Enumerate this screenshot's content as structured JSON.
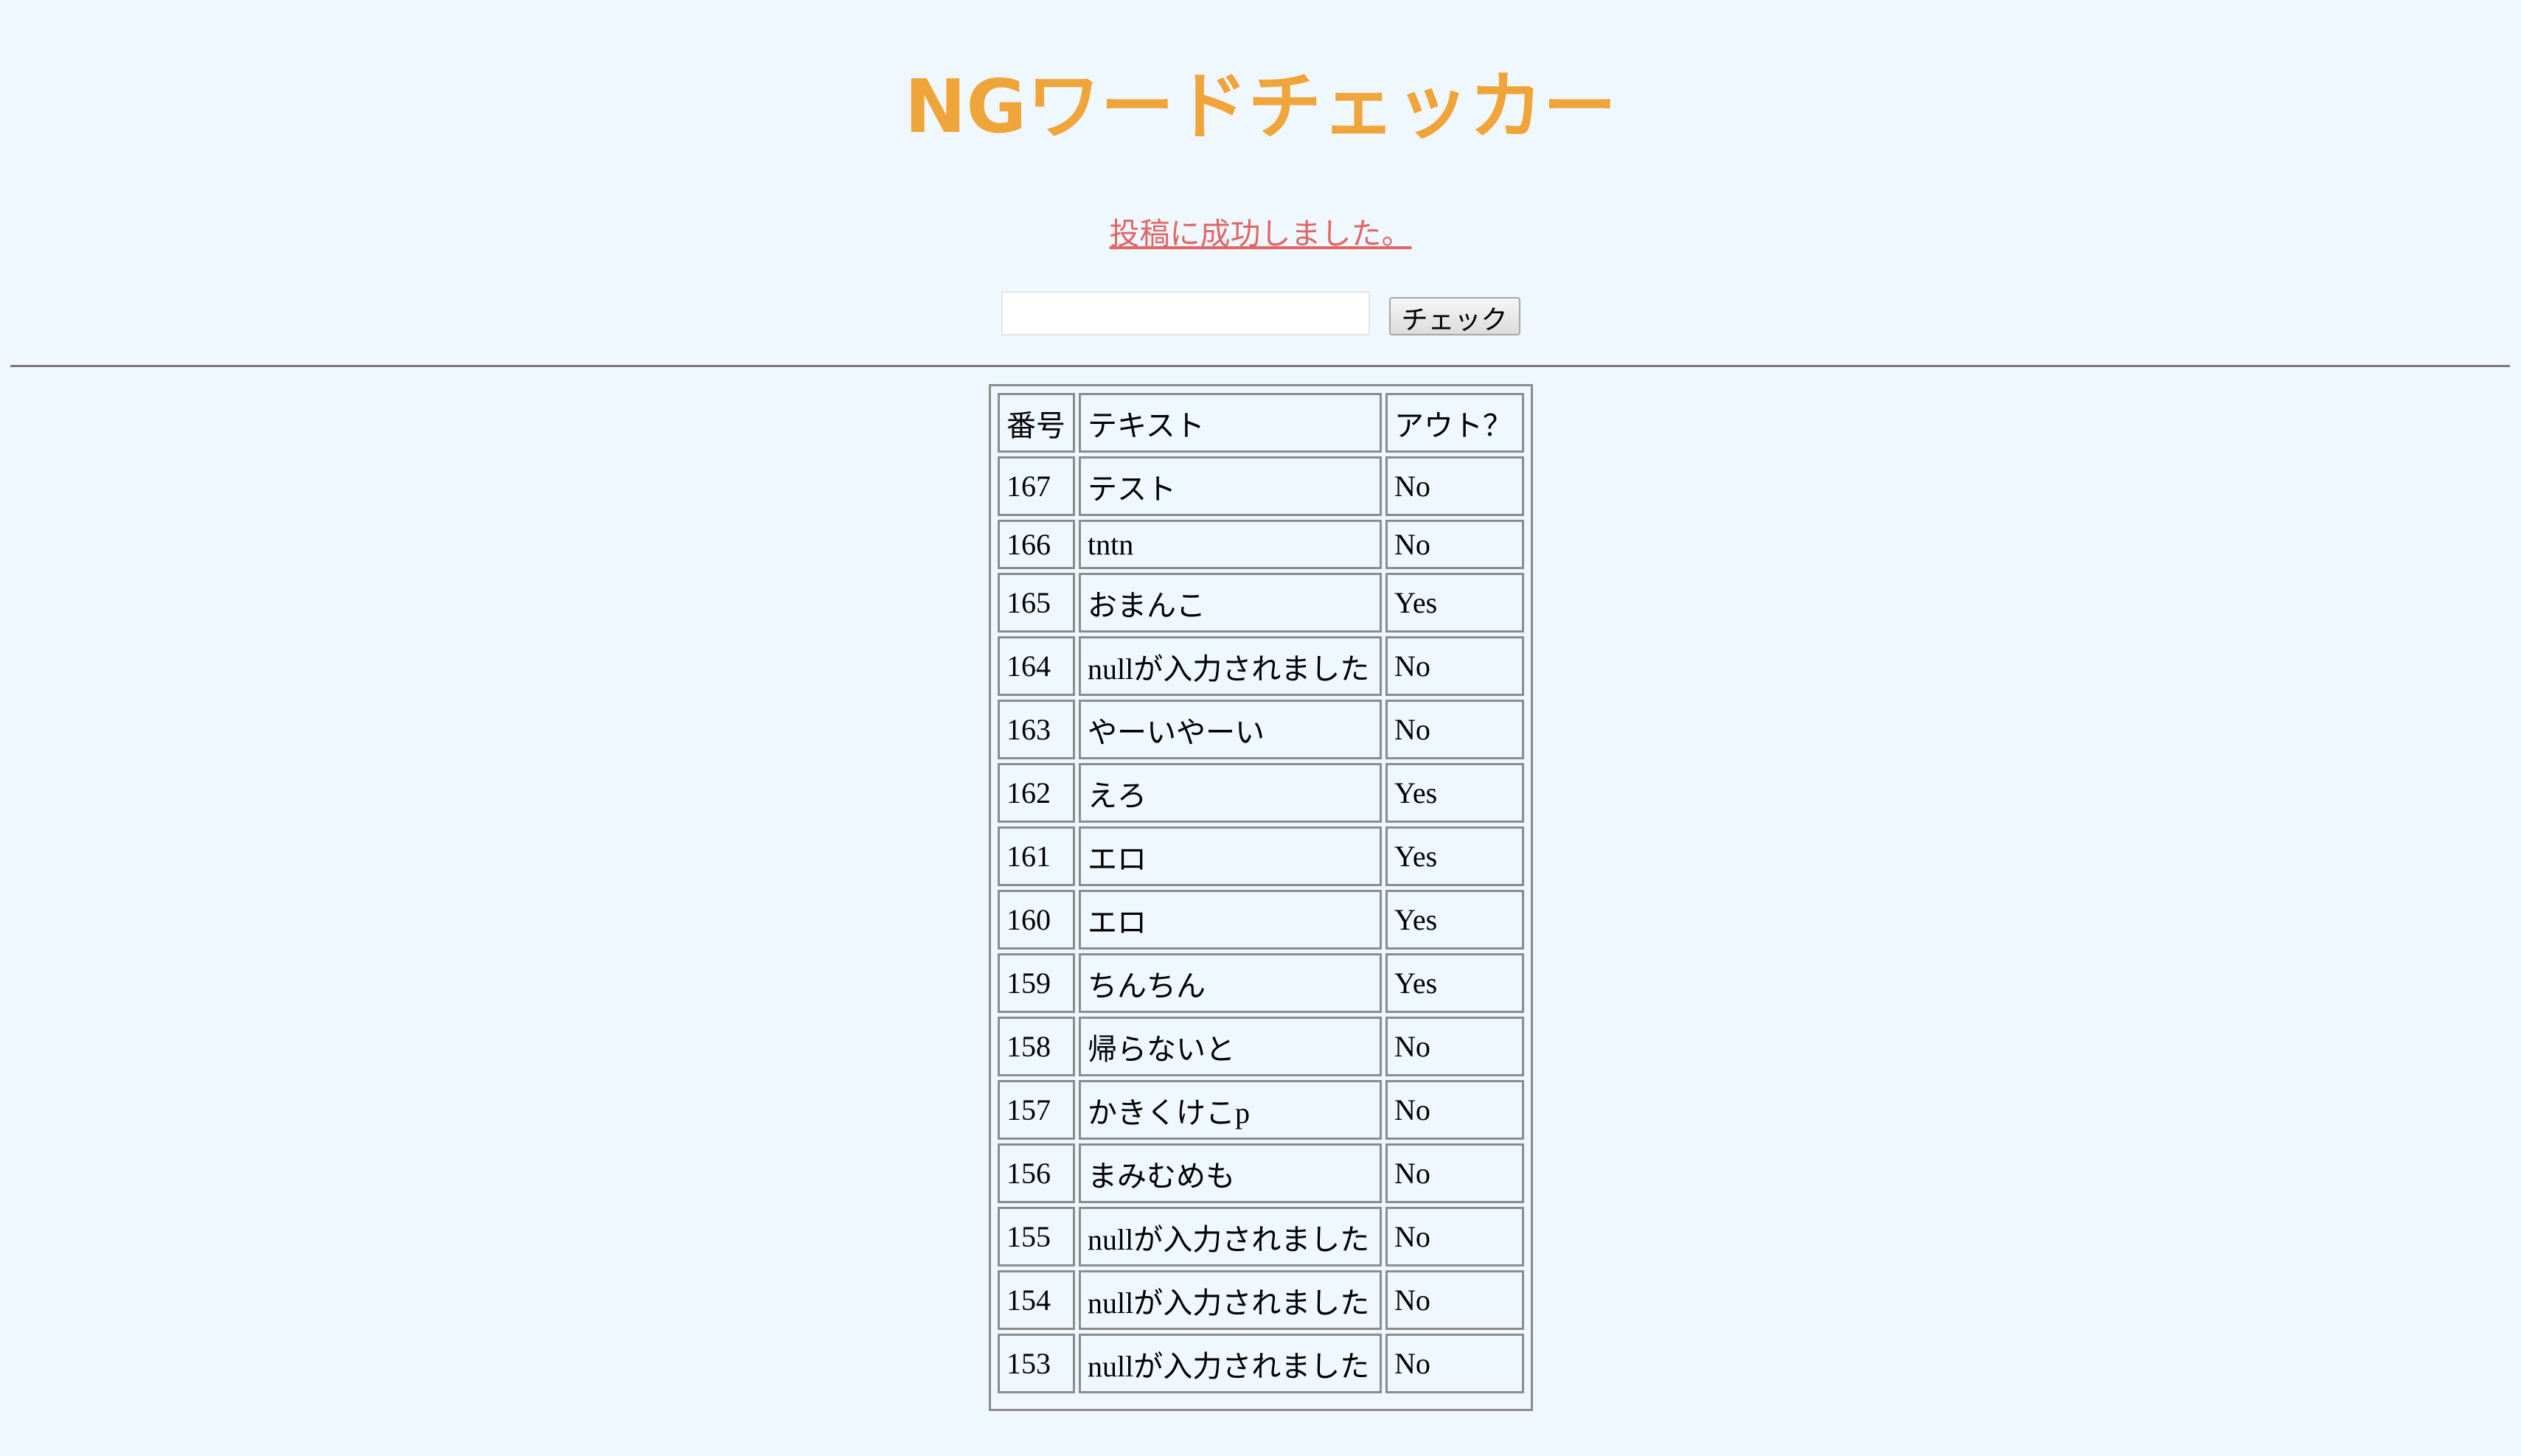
{
  "header": {
    "title": "NGワードチェッカー"
  },
  "status": {
    "message": "投稿に成功しました。"
  },
  "form": {
    "input_value": "",
    "input_placeholder": "",
    "check_label": "チェック"
  },
  "table": {
    "columns": [
      "番号",
      "テキスト",
      "アウト？"
    ],
    "rows": [
      {
        "num": "167",
        "text": "テスト",
        "out": "No"
      },
      {
        "num": "166",
        "text": "tntn",
        "out": "No"
      },
      {
        "num": "165",
        "text": "おまんこ",
        "out": "Yes"
      },
      {
        "num": "164",
        "text": "nullが入力されました",
        "out": "No"
      },
      {
        "num": "163",
        "text": "やーいやーい",
        "out": "No"
      },
      {
        "num": "162",
        "text": "えろ",
        "out": "Yes"
      },
      {
        "num": "161",
        "text": "エロ",
        "out": "Yes"
      },
      {
        "num": "160",
        "text": "エロ",
        "out": "Yes"
      },
      {
        "num": "159",
        "text": "ちんちん",
        "out": "Yes"
      },
      {
        "num": "158",
        "text": "帰らないと",
        "out": "No"
      },
      {
        "num": "157",
        "text": "かきくけこp",
        "out": "No"
      },
      {
        "num": "156",
        "text": "まみむめも",
        "out": "No"
      },
      {
        "num": "155",
        "text": "nullが入力されました",
        "out": "No"
      },
      {
        "num": "154",
        "text": "nullが入力されました",
        "out": "No"
      },
      {
        "num": "153",
        "text": "nullが入力されました",
        "out": "No"
      }
    ]
  },
  "colors": {
    "background": "#f0f8ff",
    "title": "#f0a53a",
    "status": "#e06666"
  }
}
